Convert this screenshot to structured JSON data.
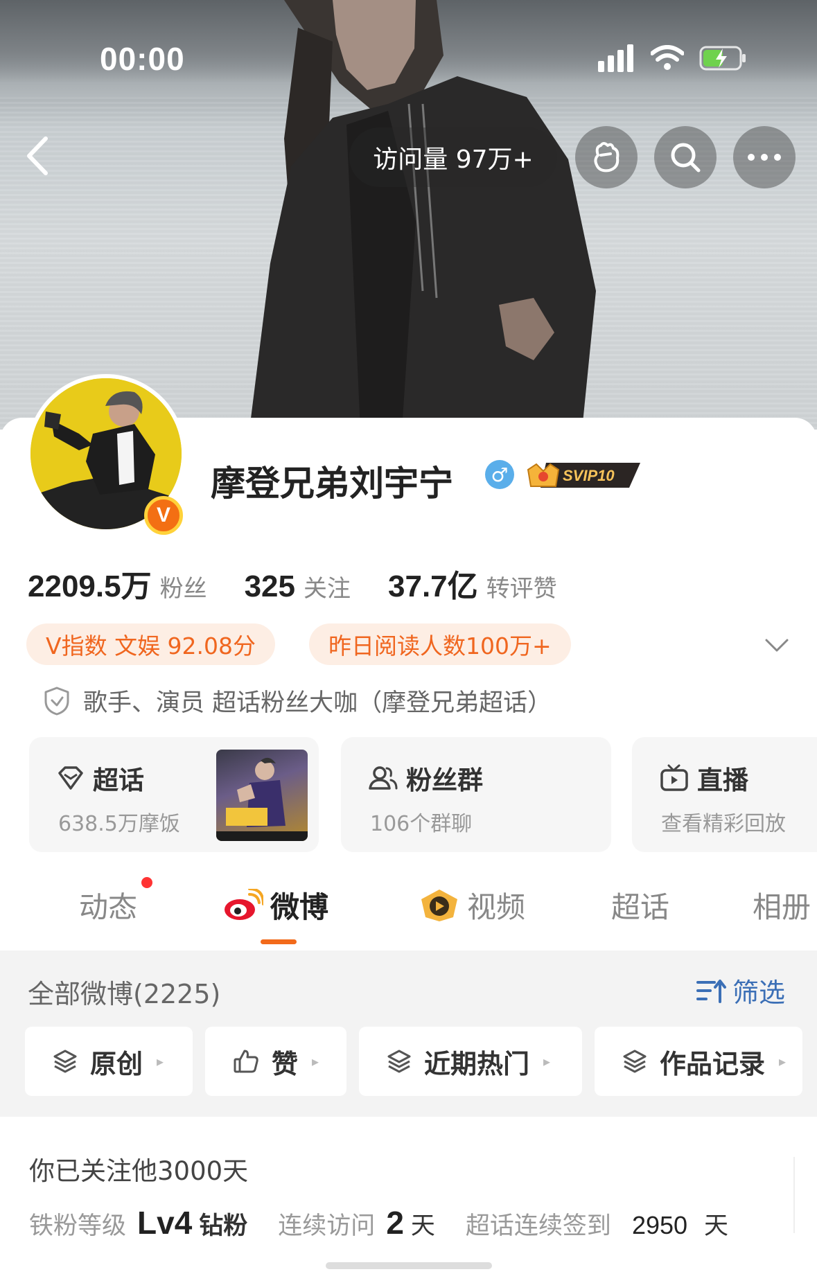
{
  "status_bar": {
    "time": "00:00",
    "icons": [
      "signal-icon",
      "wifi-icon",
      "battery-charging-icon"
    ]
  },
  "nav": {
    "visits": "访问量 97万+",
    "icons": [
      "back-arrow-icon",
      "fist-icon",
      "search-icon",
      "more-icon"
    ]
  },
  "profile": {
    "name": "摩登兄弟刘宇宁",
    "verified_badge": "V",
    "gender_symbol": "♂",
    "svip_label": "SVIP10"
  },
  "stats": [
    {
      "value": "2209.5万",
      "label": "粉丝"
    },
    {
      "value": "325",
      "label": "关注"
    },
    {
      "value": "37.7亿",
      "label": "转评赞"
    }
  ],
  "tags": [
    {
      "text": "V指数 文娱 92.08分"
    },
    {
      "text": "昨日阅读人数100万+"
    }
  ],
  "verification": "歌手、演员 超话粉丝大咖（摩登兄弟超话）",
  "feature_cards": [
    {
      "title": "超话",
      "subtitle": "638.5万摩饭",
      "icon": "diamond-icon"
    },
    {
      "title": "粉丝群",
      "subtitle": "106个群聊",
      "icon": "group-icon"
    },
    {
      "title": "直播",
      "subtitle": "查看精彩回放",
      "icon": "tv-icon"
    }
  ],
  "tabs": [
    {
      "label": "动态",
      "active": false
    },
    {
      "label": "微博",
      "active": true
    },
    {
      "label": "视频",
      "active": false
    },
    {
      "label": "超话",
      "active": false
    },
    {
      "label": "相册",
      "active": false
    }
  ],
  "weibo_list": {
    "title": "全部微博(2225)",
    "filter_label": "筛选",
    "chips": [
      {
        "label": "原创"
      },
      {
        "label": "赞"
      },
      {
        "label": "近期热门"
      },
      {
        "label": "作品记录"
      }
    ]
  },
  "follow_info": {
    "days_text": "你已关注他3000天",
    "fan_level_label": "铁粉等级",
    "fan_level_value": "Lv4",
    "fan_level_suffix": "钻粉",
    "visit_label": "连续访问",
    "visit_value": "2",
    "visit_unit": "天",
    "checkin_label": "超话连续签到",
    "checkin_value": "2950",
    "checkin_unit": "天"
  },
  "colors": {
    "accent_orange": "#f26a1b",
    "pill_bg": "#fdeee4",
    "filter_blue": "#3b6fb6",
    "gender_blue": "#5aaeea"
  }
}
